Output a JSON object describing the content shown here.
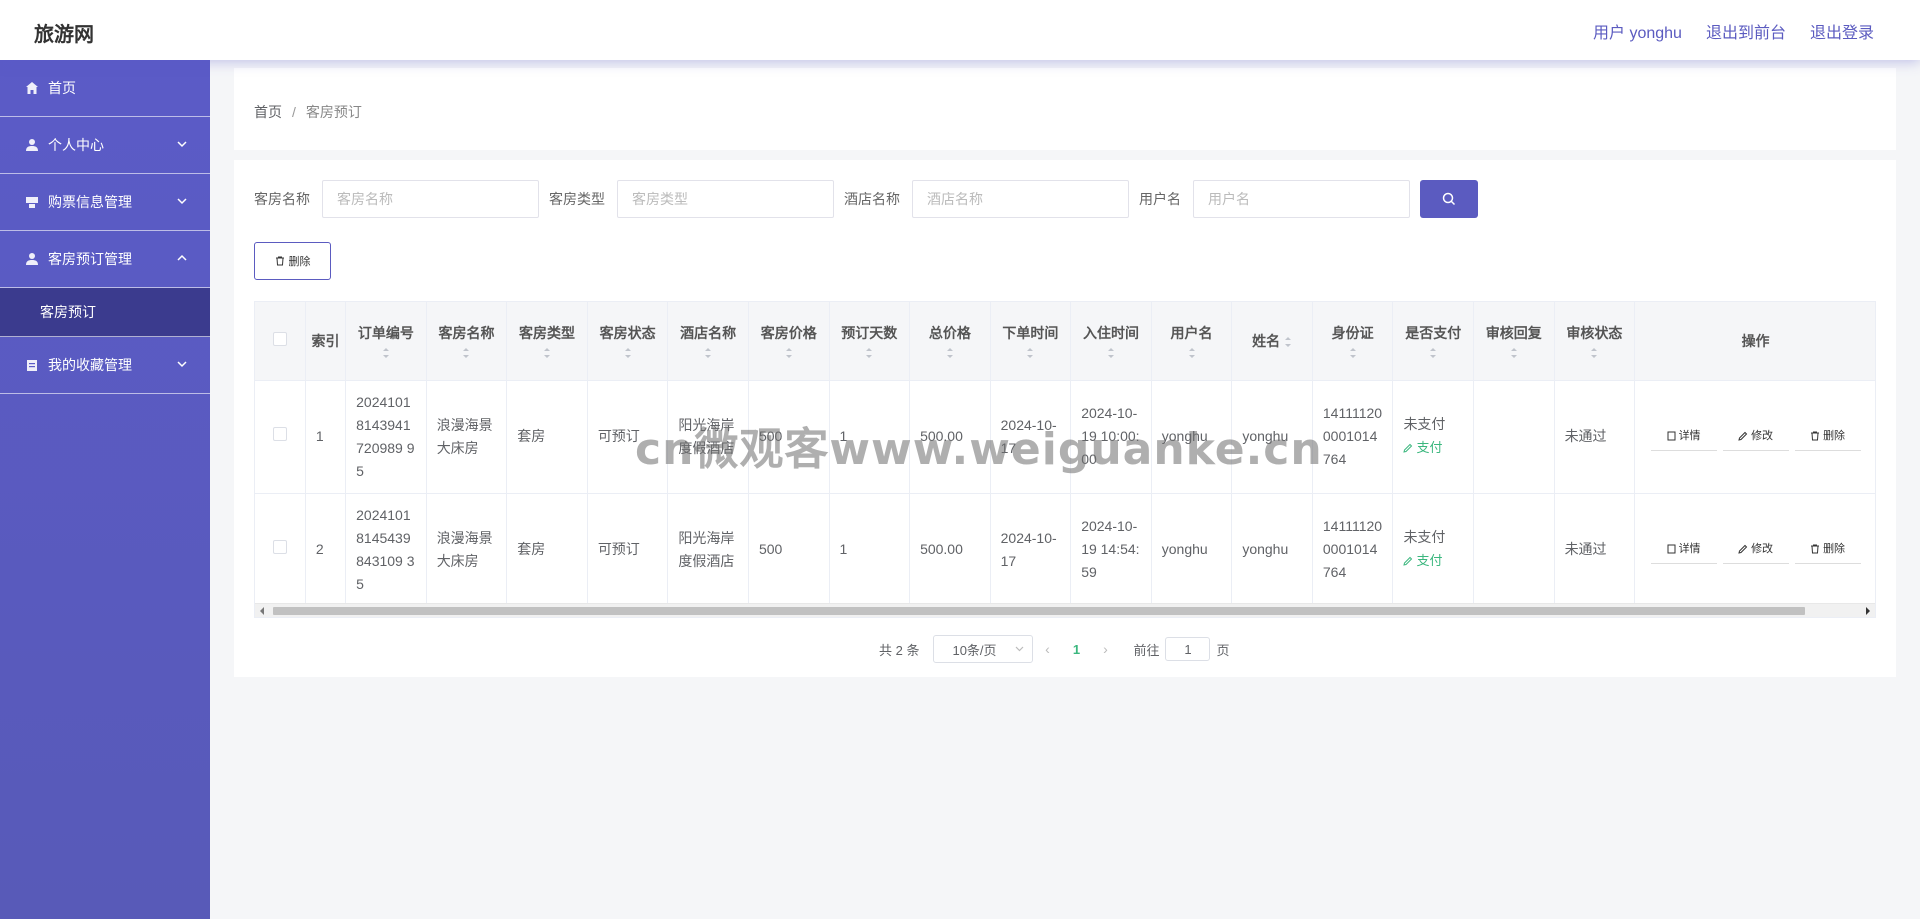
{
  "app": {
    "logo": "旅游网"
  },
  "header": {
    "user_label": "用户 yonghu",
    "front_link": "退出到前台",
    "logout_link": "退出登录"
  },
  "sidebar": {
    "items": [
      {
        "label": "首页",
        "icon": "home-icon"
      },
      {
        "label": "个人中心",
        "icon": "user-icon"
      },
      {
        "label": "购票信息管理",
        "icon": "ticket-icon"
      },
      {
        "label": "客房预订管理",
        "icon": "user-icon"
      },
      {
        "label": "我的收藏管理",
        "icon": "clipboard-icon"
      }
    ],
    "sub_item": "客房预订"
  },
  "breadcrumb": {
    "home": "首页",
    "separator": "/",
    "current": "客房预订"
  },
  "filters": [
    {
      "label": "客房名称",
      "placeholder": "客房名称"
    },
    {
      "label": "客房类型",
      "placeholder": "客房类型"
    },
    {
      "label": "酒店名称",
      "placeholder": "酒店名称"
    },
    {
      "label": "用户名",
      "placeholder": "用户名"
    }
  ],
  "toolbar": {
    "delete_label": "删除"
  },
  "table": {
    "headers": [
      "索引",
      "订单编号",
      "客房名称",
      "客房类型",
      "客房状态",
      "酒店名称",
      "客房价格",
      "预订天数",
      "总价格",
      "下单时间",
      "入住时间",
      "用户名",
      "姓名",
      "身份证",
      "是否支付",
      "审核回复",
      "审核状态",
      "操作"
    ],
    "rows": [
      {
        "index": "1",
        "order_no": "20241018143941720989 95",
        "room_name": "浪漫海景大床房",
        "room_type": "套房",
        "room_status": "可预订",
        "hotel": "阳光海岸度假酒店",
        "price": "500",
        "days": "1",
        "total": "500.00",
        "order_time": "2024-10-17",
        "checkin": "2024-10-19 10:00:00",
        "username": "yonghu",
        "name": "yonghu",
        "id_card": "141111200001014764",
        "paid": "未支付",
        "pay_action": "支付",
        "reply": "",
        "audit": "未通过"
      },
      {
        "index": "2",
        "order_no": "20241018145439843109 35",
        "room_name": "浪漫海景大床房",
        "room_type": "套房",
        "room_status": "可预订",
        "hotel": "阳光海岸度假酒店",
        "price": "500",
        "days": "1",
        "total": "500.00",
        "order_time": "2024-10-17",
        "checkin": "2024-10-19 14:54:59",
        "username": "yonghu",
        "name": "yonghu",
        "id_card": "141111200001014764",
        "paid": "未支付",
        "pay_action": "支付",
        "reply": "",
        "audit": "未通过"
      }
    ],
    "actions": {
      "detail": "详情",
      "edit": "修改",
      "delete": "删除"
    }
  },
  "pagination": {
    "total": "共 2 条",
    "page_size": "10条/页",
    "current_page": "1",
    "goto_label": "前往",
    "goto_value": "1",
    "page_suffix": "页"
  },
  "watermark": "cn微观客www.weiguanke.cn",
  "colors": {
    "accent": "#5b5bc0",
    "sidebar": "#5b5bc7",
    "sidebar_active": "#3b3b8e",
    "success": "#3bb77e"
  }
}
